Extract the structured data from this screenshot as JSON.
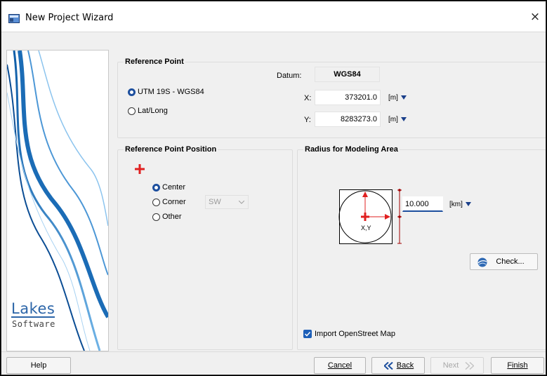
{
  "window": {
    "title": "New Project Wizard",
    "close_glyph": "×"
  },
  "branding": {
    "logo_line1": "Lakes",
    "logo_line2": "Software"
  },
  "reference_point": {
    "legend": "Reference Point",
    "datum_label": "Datum:",
    "datum_value": "WGS84",
    "option_utm": "UTM 19S - WGS84",
    "option_latlong": "Lat/Long",
    "selected": "utm",
    "x_label": "X:",
    "x_value": "373201.0",
    "x_unit": "[m]",
    "y_label": "Y:",
    "y_value": "8283273.0",
    "y_unit": "[m]"
  },
  "reference_point_position": {
    "legend": "Reference Point Position",
    "option_center": "Center",
    "option_corner": "Corner",
    "option_other": "Other",
    "selected": "center",
    "corner_value": "SW"
  },
  "radius": {
    "legend": "Radius for Modeling Area",
    "value": "10.000",
    "unit": "[km]",
    "diagram_label": "X,Y",
    "check_button": "Check...",
    "import_osm_label": "Import OpenStreet Map",
    "import_osm_checked": true
  },
  "footer": {
    "help": "Help",
    "cancel": "Cancel",
    "back": "Back",
    "next": "Next",
    "finish": "Finish"
  },
  "colors": {
    "accent": "#1d4f9e",
    "marker_red": "#e02020",
    "logo_blue": "#2c65a8"
  }
}
